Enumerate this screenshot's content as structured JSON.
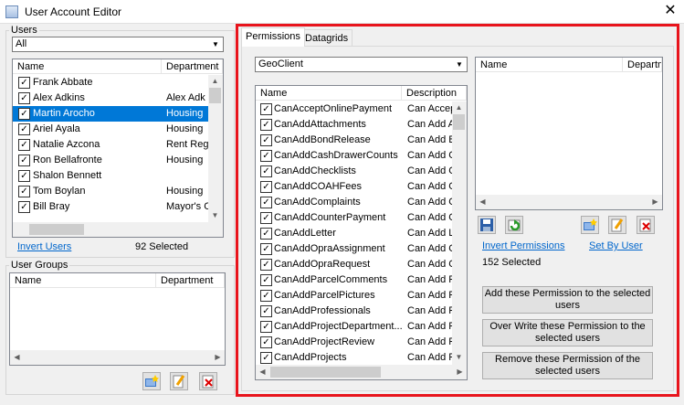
{
  "window": {
    "title": "User Account Editor",
    "close": "✕"
  },
  "users": {
    "group_label": "Users",
    "filter_value": "All",
    "columns": [
      "Name",
      "Department"
    ],
    "rows": [
      {
        "name": "Frank Abbate",
        "dept": "",
        "checked": true,
        "selected": false
      },
      {
        "name": "Alex Adkins",
        "dept": "Alex Adk",
        "checked": true,
        "selected": false
      },
      {
        "name": "Martin Arocho",
        "dept": "Housing",
        "checked": true,
        "selected": true
      },
      {
        "name": "Ariel Ayala",
        "dept": "Housing",
        "checked": true,
        "selected": false
      },
      {
        "name": "Natalie Azcona",
        "dept": "Rent Reg",
        "checked": true,
        "selected": false
      },
      {
        "name": "Ron Bellafronte",
        "dept": "Housing",
        "checked": true,
        "selected": false
      },
      {
        "name": "Shalon Bennett",
        "dept": "",
        "checked": true,
        "selected": false
      },
      {
        "name": "Tom Boylan",
        "dept": "Housing",
        "checked": true,
        "selected": false
      },
      {
        "name": "Bill Bray",
        "dept": "Mayor's C",
        "checked": true,
        "selected": false
      }
    ],
    "invert_link": "Invert Users",
    "selected_count": "92 Selected"
  },
  "user_groups": {
    "group_label": "User Groups",
    "columns": [
      "Name",
      "Department"
    ]
  },
  "tabs": [
    {
      "label": "Permissions",
      "active": true
    },
    {
      "label": "Datagrids",
      "active": false
    }
  ],
  "permissions": {
    "module_value": "GeoClient",
    "columns": [
      "Name",
      "Description"
    ],
    "rows": [
      {
        "name": "CanAcceptOnlinePayment",
        "desc": "Can Accep"
      },
      {
        "name": "CanAddAttachments",
        "desc": "Can Add A"
      },
      {
        "name": "CanAddBondRelease",
        "desc": "Can Add B"
      },
      {
        "name": "CanAddCashDrawerCounts",
        "desc": "Can Add C"
      },
      {
        "name": "CanAddChecklists",
        "desc": "Can Add C"
      },
      {
        "name": "CanAddCOAHFees",
        "desc": "Can Add C"
      },
      {
        "name": "CanAddComplaints",
        "desc": "Can Add C"
      },
      {
        "name": "CanAddCounterPayment",
        "desc": "Can Add C"
      },
      {
        "name": "CanAddLetter",
        "desc": "Can Add L"
      },
      {
        "name": "CanAddOpraAssignment",
        "desc": "Can Add C"
      },
      {
        "name": "CanAddOpraRequest",
        "desc": "Can Add C"
      },
      {
        "name": "CanAddParcelComments",
        "desc": "Can Add F"
      },
      {
        "name": "CanAddParcelPictures",
        "desc": "Can Add F"
      },
      {
        "name": "CanAddProfessionals",
        "desc": "Can Add F"
      },
      {
        "name": "CanAddProjectDepartment...",
        "desc": "Can Add F"
      },
      {
        "name": "CanAddProjectReview",
        "desc": "Can Add F"
      },
      {
        "name": "CanAddProjects",
        "desc": "Can Add F"
      }
    ],
    "right_columns": [
      "Name",
      "Department"
    ],
    "invert_link": "Invert Permissions",
    "set_by_user_link": "Set By User",
    "selected_count": "152 Selected",
    "add_button": "Add these Permission to the selected users",
    "overwrite_button": "Over Write these Permission to the selected users",
    "remove_button": "Remove these Permission of the selected users"
  },
  "icons": {
    "save": "save-icon",
    "refresh": "refresh-icon",
    "new": "new-icon",
    "edit": "edit-icon",
    "delete": "delete-icon",
    "check": "✓"
  },
  "colors": {
    "selection": "#0078d7",
    "link": "#0066cc",
    "highlight_frame": "#e8141c"
  }
}
